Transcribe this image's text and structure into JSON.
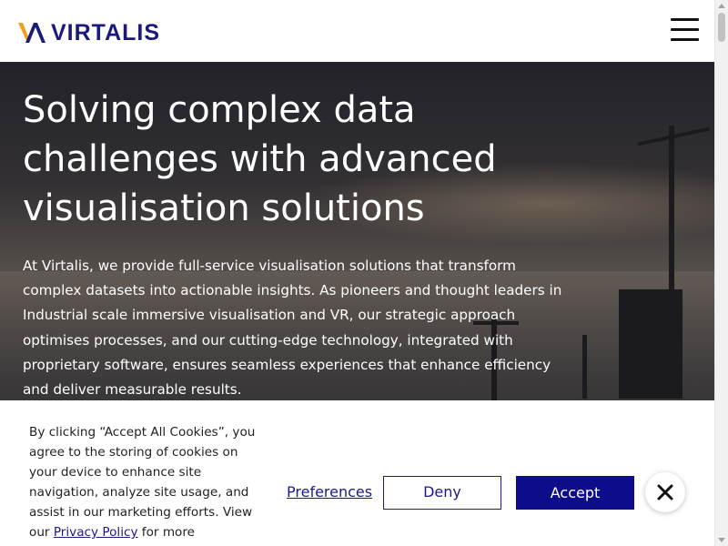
{
  "header": {
    "logo_text": "VIRTALIS",
    "logo_icon": "virtalis-logo-mark",
    "menu_icon": "hamburger-menu-icon"
  },
  "hero": {
    "title": "Solving complex data challenges with advanced visualisation solutions",
    "body": "At Virtalis, we provide full-service visualisation solutions that transform complex datasets into actionable insights. As pioneers and thought leaders in Industrial scale immersive visualisation and VR, our strategic approach optimises processes, and our cutting-edge technology, integrated with proprietary software, ensures seamless experiences that enhance efficiency and deliver measurable results."
  },
  "cookie_banner": {
    "text_before_link": "By clicking “Accept All Cookies”, you agree to the storing of cookies on your device to enhance site navigation, analyze site usage, and assist in our marketing efforts. View our ",
    "privacy_link": "Privacy Policy",
    "text_after_link": " for more",
    "preferences_label": "Preferences",
    "deny_label": "Deny",
    "accept_label": "Accept",
    "close_icon": "close-icon"
  },
  "colors": {
    "brand_navy": "#1a1a7a",
    "brand_gold": "#f0a020",
    "accept_bg": "#0d0d8c"
  }
}
